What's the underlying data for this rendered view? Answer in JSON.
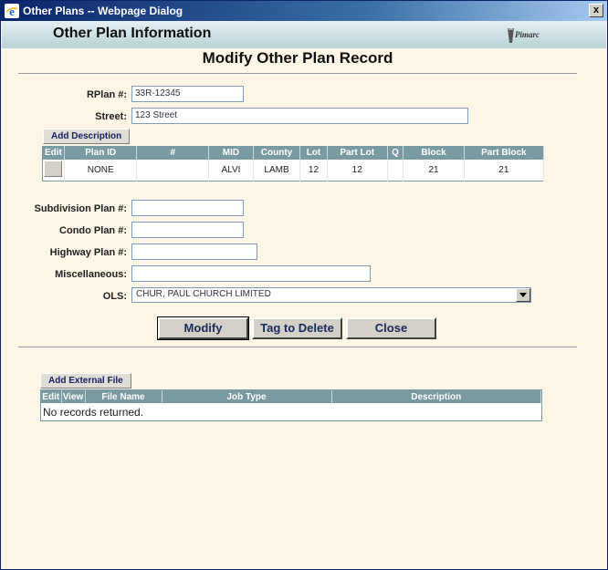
{
  "window": {
    "title": "Other Plans -- Webpage Dialog",
    "close_glyph": "x"
  },
  "header": {
    "title": "Other Plan Information",
    "logo_text": "Pimarc"
  },
  "page": {
    "heading": "Modify Other Plan Record"
  },
  "form": {
    "rplan_label": "RPlan #:",
    "rplan_value": "33R-12345",
    "street_label": "Street:",
    "street_value": "123 Street",
    "add_description_label": "Add Description",
    "subdivision_label": "Subdivision Plan #:",
    "subdivision_value": "",
    "condo_label": "Condo Plan #:",
    "condo_value": "",
    "highway_label": "Highway Plan #:",
    "highway_value": "",
    "misc_label": "Miscellaneous:",
    "misc_value": "",
    "ols_label": "OLS:",
    "ols_value": "CHUR, PAUL CHURCH LIMITED"
  },
  "description_table": {
    "headers": [
      "Edit",
      "Plan ID",
      "#",
      "MID",
      "County",
      "Lot",
      "Part Lot",
      "Q",
      "Block",
      "Part Block"
    ],
    "rows": [
      {
        "plan_id": "NONE",
        "num": "",
        "mid": "ALVI",
        "county": "LAMB",
        "lot": "12",
        "part_lot": "12",
        "q": "",
        "block": "21",
        "part_block": "21"
      }
    ]
  },
  "actions": {
    "modify": "Modify",
    "tag_delete": "Tag to Delete",
    "close": "Close"
  },
  "files": {
    "add_external_label": "Add External File",
    "headers": [
      "Edit",
      "View",
      "File Name",
      "Job Type",
      "Description"
    ],
    "empty_text": "No records returned."
  }
}
